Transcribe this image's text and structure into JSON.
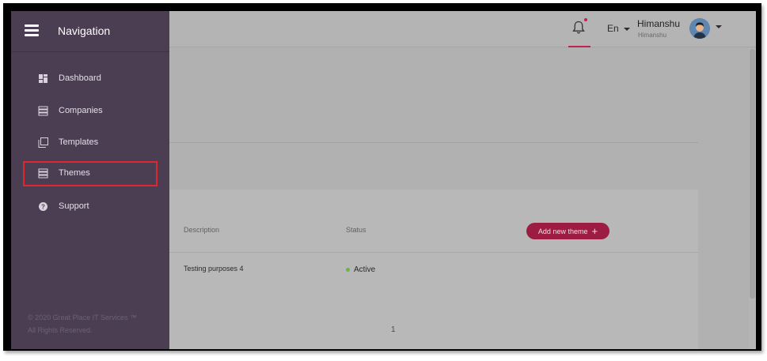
{
  "header": {
    "language": "En",
    "user_name": "Himanshu",
    "user_subtitle": "Himanshu",
    "bell_icon": "bell-icon",
    "accent_color": "#c0214f"
  },
  "sidebar": {
    "title": "Navigation",
    "items": [
      {
        "label": "Dashboard",
        "icon": "dashboard-icon"
      },
      {
        "label": "Companies",
        "icon": "list-icon"
      },
      {
        "label": "Templates",
        "icon": "copy-icon"
      },
      {
        "label": "Themes",
        "icon": "list-icon"
      },
      {
        "label": "Support",
        "icon": "question-icon"
      }
    ],
    "active_item": "Themes",
    "footer_line1": "© 2020 Great Place IT Services ™",
    "footer_line2": "All Rights Reserved."
  },
  "table": {
    "columns": [
      "Description",
      "Status"
    ],
    "add_button_label": "Add new theme",
    "rows": [
      {
        "description": "Testing purposes 4",
        "status": "Active"
      }
    ],
    "page": "1"
  },
  "colors": {
    "sidebar_bg": "#4b3e52",
    "button_bg": "#9c1c43",
    "highlight_border": "#e0262e",
    "active_status": "#6fb340"
  }
}
